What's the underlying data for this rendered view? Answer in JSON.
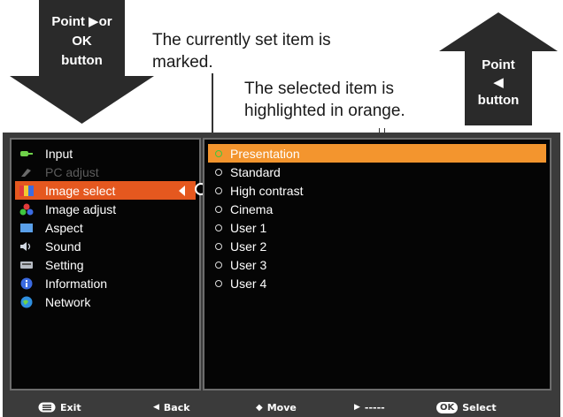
{
  "callouts": {
    "left_arrow": "Point ▶or\nOK\nbutton",
    "right_arrow": "Point\n◀\nbutton",
    "current_note": "The currently set item is\nmarked.",
    "selected_note": "The selected item is\nhighlighted in orange."
  },
  "menu": {
    "items": [
      {
        "label": "Input",
        "icon": "input-icon"
      },
      {
        "label": "PC adjust",
        "icon": "pc-adjust-icon"
      },
      {
        "label": "Image select",
        "icon": "image-select-icon"
      },
      {
        "label": "Image adjust",
        "icon": "image-adjust-icon"
      },
      {
        "label": "Aspect",
        "icon": "aspect-icon"
      },
      {
        "label": "Sound",
        "icon": "sound-icon"
      },
      {
        "label": "Setting",
        "icon": "setting-icon"
      },
      {
        "label": "Information",
        "icon": "information-icon"
      },
      {
        "label": "Network",
        "icon": "network-icon"
      }
    ],
    "selected": "Image select",
    "disabled": "PC adjust"
  },
  "options": {
    "items": [
      "Presentation",
      "Standard",
      "High contrast",
      "Cinema",
      "User 1",
      "User 2",
      "User 3",
      "User 4"
    ],
    "current": "Presentation",
    "highlighted": "Presentation"
  },
  "statusbar": {
    "exit": "Exit",
    "back": "Back",
    "move": "Move",
    "next": "-----",
    "ok_badge": "OK",
    "select": "Select"
  },
  "colors": {
    "menu_selected": "#e5581f",
    "option_highlight": "#f3952e",
    "current_marker": "#3fc63f",
    "osd_frame": "#3b3b3b"
  }
}
